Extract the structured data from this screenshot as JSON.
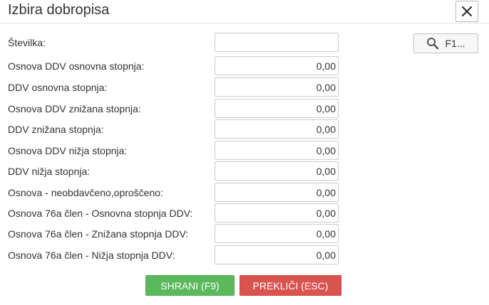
{
  "dialog": {
    "title": "Izbira dobropisa",
    "close_icon": "close-icon"
  },
  "number": {
    "label": "Številka:",
    "value": ""
  },
  "search_button": {
    "icon": "search-icon",
    "label": "F1..."
  },
  "rows": [
    {
      "label": "Osnova DDV osnovna stopnja:",
      "value": "0,00"
    },
    {
      "label": "DDV osnovna stopnja:",
      "value": "0,00"
    },
    {
      "label": "Osnova DDV znižana stopnja:",
      "value": "0,00"
    },
    {
      "label": "DDV znižana stopnja:",
      "value": "0,00"
    },
    {
      "label": "Osnova DDV nižja stopnja:",
      "value": "0,00"
    },
    {
      "label": "DDV nižja stopnja:",
      "value": "0,00"
    },
    {
      "label": "Osnova - neobdavčeno,oproščeno:",
      "value": "0,00"
    },
    {
      "label": "Osnova 76a člen - Osnovna stopnja DDV:",
      "value": "0,00"
    },
    {
      "label": "Osnova 76a člen - Znižana stopnja DDV:",
      "value": "0,00"
    },
    {
      "label": "Osnova 76a člen - Nižja stopnja DDV:",
      "value": "0,00"
    }
  ],
  "buttons": {
    "save_label": "SHRANI (F9)",
    "cancel_label": "PREKLIČI (ESC)"
  },
  "colors": {
    "save": "#5cb85c",
    "cancel": "#d9534f"
  }
}
